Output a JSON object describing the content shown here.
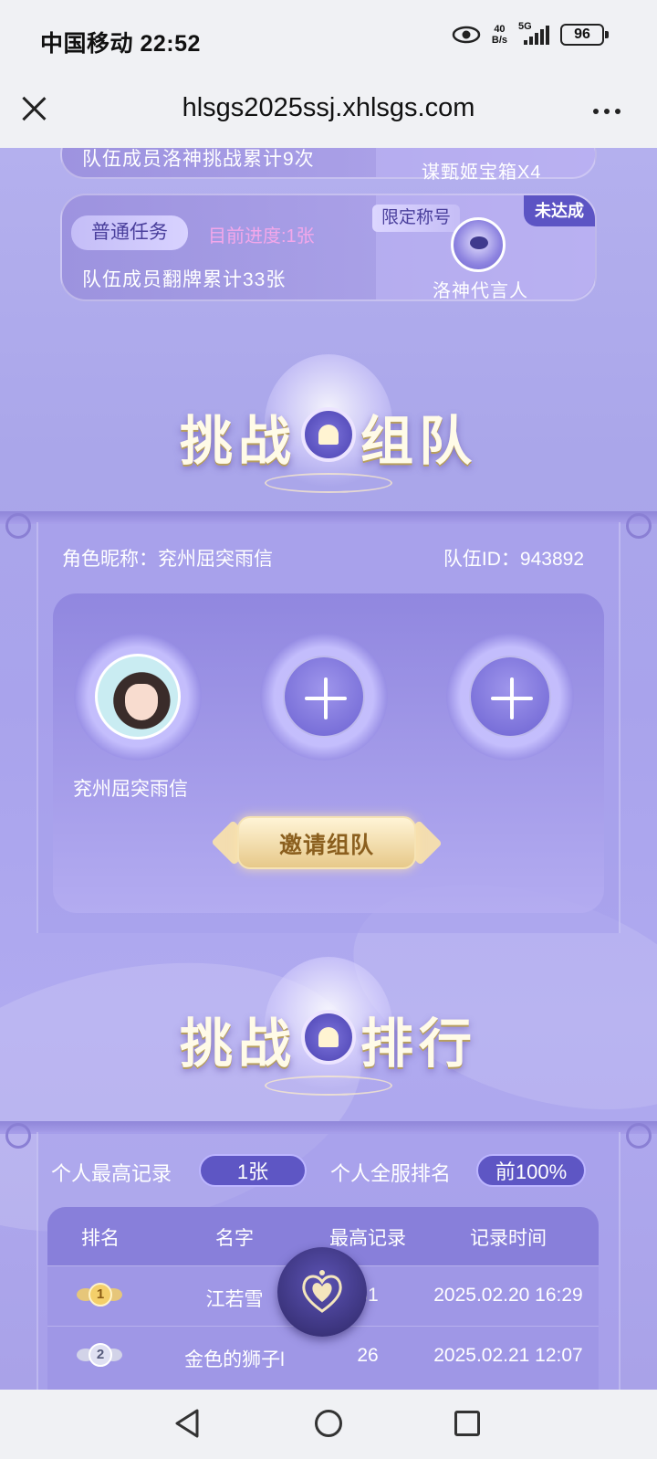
{
  "status_bar": {
    "carrier_time": "中国移动 22:52",
    "net_speed_value": "40",
    "net_speed_unit": "B/s",
    "network": "5G",
    "battery": "96",
    "icons": [
      "eye-icon",
      "signal-icon",
      "battery-icon"
    ]
  },
  "browser": {
    "url": "hlsgs2025ssj.xhlsgs.com",
    "icons": [
      "close-icon",
      "more-icon"
    ]
  },
  "tasks": [
    {
      "description": "队伍成员洛神挑战累计9次",
      "reward": "谋甄姬宝箱X4"
    },
    {
      "type": "普通任务",
      "progress": "目前进度:1张",
      "description": "队伍成员翻牌累计33张",
      "reward_tag": "限定称号",
      "reward_name": "洛神代言人",
      "status": "未达成"
    }
  ],
  "team_section": {
    "title_left": "挑战",
    "title_right": "组队",
    "nickname_label": "角色昵称：兖州屈突雨信",
    "team_id_label": "队伍ID：943892",
    "member_name": "兖州屈突雨信",
    "invite_button": "邀请组队"
  },
  "rank_section": {
    "title_left": "挑战",
    "title_right": "排行",
    "best_record_label": "个人最高记录",
    "best_record_value": "1张",
    "server_rank_label": "个人全服排名",
    "server_rank_value": "前100%",
    "headers": [
      "排名",
      "名字",
      "最高记录",
      "记录时间"
    ],
    "rows": [
      {
        "rank": "1",
        "name": "江若雪",
        "record": "31",
        "time": "2025.02.20 16:29"
      },
      {
        "rank": "2",
        "name": "金色的狮子l",
        "record": "26",
        "time": "2025.02.21 12:07"
      }
    ]
  },
  "colors": {
    "background": "#aaa6ea",
    "accent": "#5e56c4",
    "progress_text": "#f3a7ea",
    "gold": "#e7c98a"
  }
}
